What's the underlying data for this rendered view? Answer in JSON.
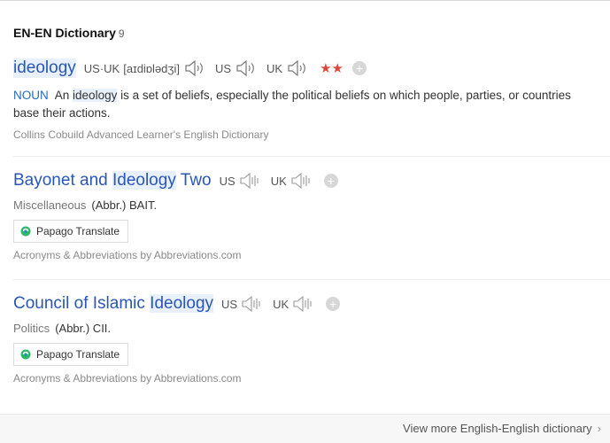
{
  "section": {
    "title": "EN-EN Dictionary",
    "count": "9"
  },
  "entry1": {
    "word": "ideology",
    "pron_label": "US·UK",
    "ipa": "[aɪdiɒlədʒi]",
    "us": "US",
    "uk": "UK",
    "stars": "★★",
    "pos": "NOUN",
    "def_pre": "An",
    "def_hl": "ideology",
    "def_post": "is a set of beliefs, especially the political beliefs on which people, parties, or countries base their actions.",
    "source": "Collins Cobuild Advanced Learner's English Dictionary"
  },
  "entry2": {
    "word_a": "Bayonet and",
    "word_hl": "Ideology",
    "word_b": "Two",
    "us": "US",
    "uk": "UK",
    "category": "Miscellaneous",
    "gloss": "(Abbr.) BAIT.",
    "papago": "Papago Translate",
    "source": "Acronyms & Abbreviations by Abbreviations.com"
  },
  "entry3": {
    "word_a": "Council of Islamic",
    "word_hl": "Ideology",
    "us": "US",
    "uk": "UK",
    "category": "Politics",
    "gloss": "(Abbr.) CII.",
    "papago": "Papago Translate",
    "source": "Acronyms & Abbreviations by Abbreviations.com"
  },
  "footer": {
    "more": "View more English-English dictionary"
  }
}
